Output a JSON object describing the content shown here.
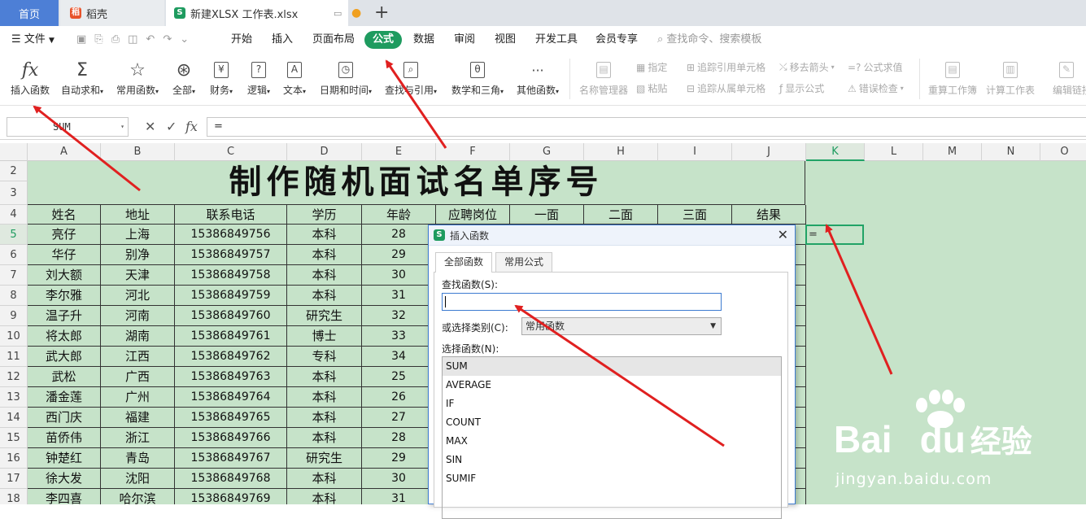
{
  "tabs": {
    "home": "首页",
    "daoke": "稻壳",
    "file": "新建XLSX 工作表.xlsx"
  },
  "menu": {
    "file": "文件",
    "items": [
      "开始",
      "插入",
      "页面布局",
      "公式",
      "数据",
      "审阅",
      "视图",
      "开发工具",
      "会员专享"
    ],
    "search": "查找命令、搜索模板"
  },
  "ribbon": {
    "buttons": [
      {
        "label": "插入函数",
        "icon": "fx"
      },
      {
        "label": "自动求和",
        "icon": "Σ",
        "dropdown": true
      },
      {
        "label": "常用函数",
        "icon": "☆",
        "dropdown": true
      },
      {
        "label": "全部",
        "icon": "⊛",
        "dropdown": true
      },
      {
        "label": "财务",
        "icon": "¥",
        "dropdown": true
      },
      {
        "label": "逻辑",
        "icon": "?",
        "dropdown": true
      },
      {
        "label": "文本",
        "icon": "A",
        "dropdown": true
      },
      {
        "label": "日期和时间",
        "icon": "◷",
        "dropdown": true
      },
      {
        "label": "查找与引用",
        "icon": "⌕",
        "dropdown": true
      },
      {
        "label": "数学和三角",
        "icon": "θ",
        "dropdown": true
      },
      {
        "label": "其他函数",
        "icon": "···",
        "dropdown": true
      }
    ],
    "name_manager": "名称管理器",
    "assign": "指定",
    "paste": "粘贴",
    "trace_prec": "追踪引用单元格",
    "trace_dep": "追踪从属单元格",
    "remove_arrows": "移去箭头",
    "show_formula": "显示公式",
    "eval_formula": "公式求值",
    "error_check": "错误检查",
    "recalc_book": "重算工作簿",
    "calc_sheet": "计算工作表",
    "edit_links": "编辑链接"
  },
  "formula_bar": {
    "name_box": "SUM",
    "value": "="
  },
  "sheet": {
    "columns": [
      "A",
      "B",
      "C",
      "D",
      "E",
      "F",
      "G",
      "H",
      "I",
      "J",
      "K",
      "L",
      "M",
      "N",
      "O"
    ],
    "row_numbers": [
      "2",
      "3",
      "4",
      "5",
      "6",
      "7",
      "8",
      "9",
      "10",
      "11",
      "12",
      "13",
      "14",
      "15",
      "16",
      "17",
      "18"
    ],
    "title": "制作随机面试名单序号",
    "headers": [
      "姓名",
      "地址",
      "联系电话",
      "学历",
      "年龄",
      "应聘岗位",
      "一面",
      "二面",
      "三面",
      "结果"
    ],
    "rows": [
      [
        "亮仔",
        "上海",
        "15386849756",
        "本科",
        "28"
      ],
      [
        "华仔",
        "别净",
        "15386849757",
        "本科",
        "29"
      ],
      [
        "刘大额",
        "天津",
        "15386849758",
        "本科",
        "30"
      ],
      [
        "李尔雅",
        "河北",
        "15386849759",
        "本科",
        "31"
      ],
      [
        "温子升",
        "河南",
        "15386849760",
        "研究生",
        "32"
      ],
      [
        "将太郎",
        "湖南",
        "15386849761",
        "博士",
        "33"
      ],
      [
        "武大郎",
        "江西",
        "15386849762",
        "专科",
        "34"
      ],
      [
        "武松",
        "广西",
        "15386849763",
        "本科",
        "25"
      ],
      [
        "潘金莲",
        "广州",
        "15386849764",
        "本科",
        "26"
      ],
      [
        "西门庆",
        "福建",
        "15386849765",
        "本科",
        "27"
      ],
      [
        "苗侨伟",
        "浙江",
        "15386849766",
        "本科",
        "28"
      ],
      [
        "钟楚红",
        "青岛",
        "15386849767",
        "研究生",
        "29"
      ],
      [
        "徐大发",
        "沈阳",
        "15386849768",
        "本科",
        "30"
      ],
      [
        "李四喜",
        "哈尔滨",
        "15386849769",
        "本科",
        "31"
      ]
    ],
    "active_cell_value": "="
  },
  "dialog": {
    "title": "插入函数",
    "tabs": [
      "全部函数",
      "常用公式"
    ],
    "search_label": "查找函数(S):",
    "category_label": "或选择类别(C):",
    "category_value": "常用函数",
    "list_label": "选择函数(N):",
    "functions": [
      "SUM",
      "AVERAGE",
      "IF",
      "COUNT",
      "MAX",
      "SIN",
      "SUMIF"
    ]
  },
  "watermark": {
    "brand_a": "Bai",
    "brand_b": "du",
    "brand_c": "经验",
    "url": "jingyan.baidu.com"
  },
  "colors": {
    "accent_green": "#1e9b5f",
    "sheet_bg": "#c6e3c9",
    "arrow": "#e02020",
    "home_tab": "#4d7fd6"
  }
}
